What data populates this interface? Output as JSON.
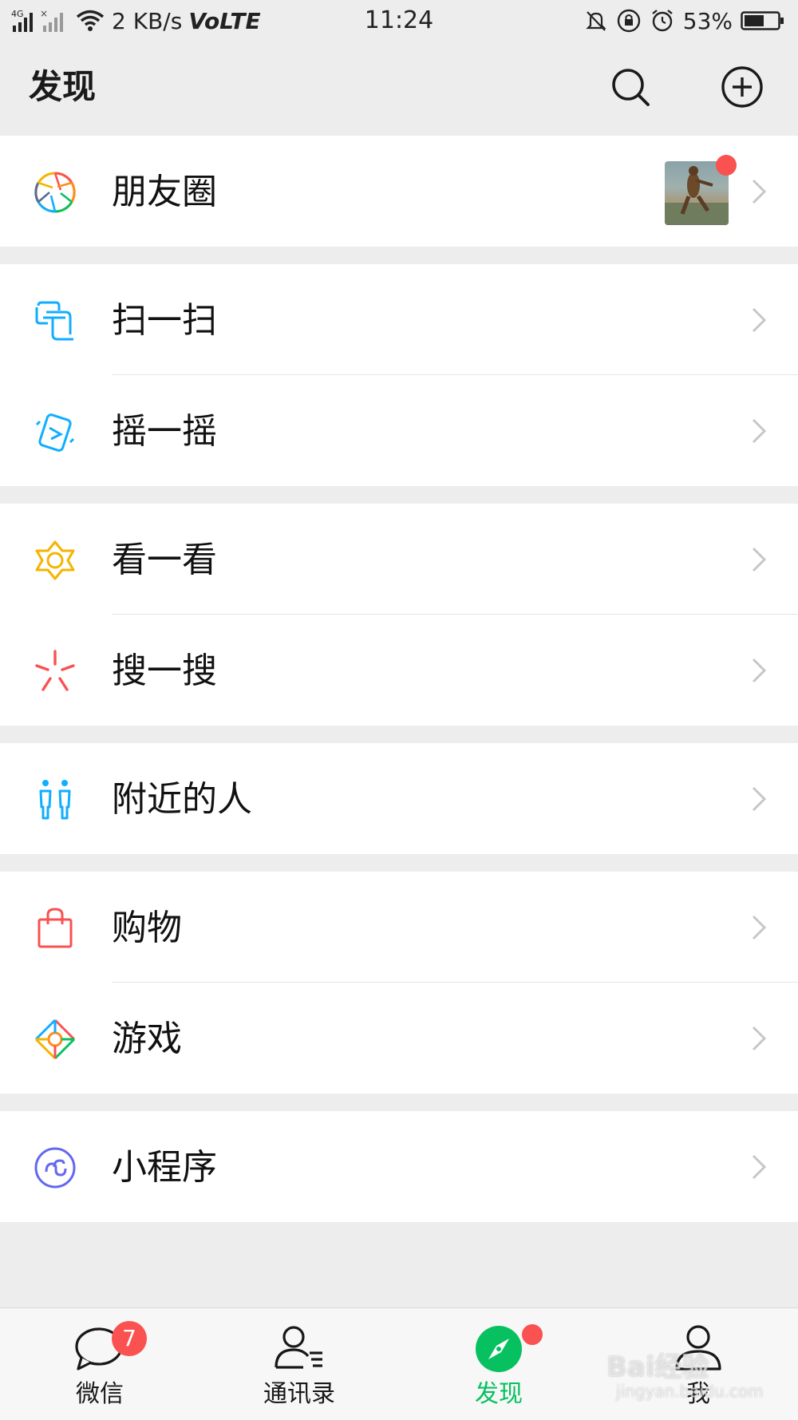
{
  "status_bar": {
    "network": "4G",
    "speed": "2 KB/s",
    "volte": "VoLTE",
    "time": "11:24",
    "battery": "53%"
  },
  "header": {
    "title": "发现",
    "search_icon": "search-icon",
    "add_icon": "plus-circle-icon"
  },
  "menu": {
    "moments": "朋友圈",
    "scan": "扫一扫",
    "shake": "摇一摇",
    "top_stories": "看一看",
    "search": "搜一搜",
    "people_nearby": "附近的人",
    "shopping": "购物",
    "games": "游戏",
    "mini_programs": "小程序"
  },
  "tabbar": {
    "chats": "微信",
    "chats_badge": "7",
    "contacts": "通讯录",
    "discover": "发现",
    "me": "我"
  },
  "watermark": {
    "text": "Bai经验",
    "sub": "jingyan.baidu.com"
  },
  "colors": {
    "accent_green": "#07c160",
    "badge_red": "#fa5151",
    "background": "#ededed"
  }
}
